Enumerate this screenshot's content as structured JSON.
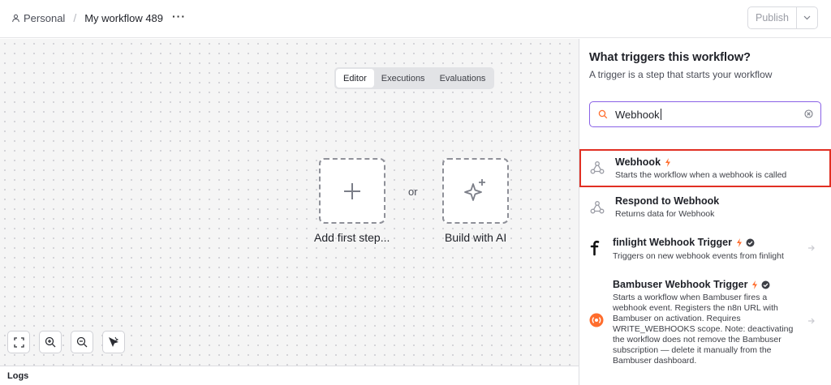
{
  "header": {
    "project": "Personal",
    "workflow_name": "My workflow 489",
    "more": "···",
    "publish_label": "Publish"
  },
  "canvas": {
    "tabs": [
      {
        "label": "Editor",
        "active": true
      },
      {
        "label": "Executions",
        "active": false
      },
      {
        "label": "Evaluations",
        "active": false
      }
    ],
    "add_first_step": "Add first step...",
    "or": "or",
    "build_with_ai": "Build with AI",
    "controls": [
      "fit-view-icon",
      "zoom-in-icon",
      "zoom-out-icon",
      "tidy-up-icon"
    ]
  },
  "logs": {
    "label": "Logs"
  },
  "panel": {
    "title": "What triggers this workflow?",
    "subtitle": "A trigger is a step that starts your workflow",
    "search": {
      "value": "Webhook"
    },
    "results": [
      {
        "name": "Webhook",
        "description": "Starts the workflow when a webhook is called",
        "badge_bolt": true,
        "verified": false,
        "selected": true,
        "icon": "webhook-icon"
      },
      {
        "name": "Respond to Webhook",
        "description": "Returns data for Webhook",
        "badge_bolt": false,
        "verified": false,
        "selected": false,
        "icon": "webhook-icon"
      },
      {
        "name": "finlight Webhook Trigger",
        "description": "Triggers on new webhook events from finlight",
        "badge_bolt": true,
        "verified": true,
        "selected": false,
        "icon": "finlight-logo-icon"
      },
      {
        "name": "Bambuser Webhook Trigger",
        "description_lines": [
          "Starts a workflow when Bambuser fires a",
          "webhook event. Registers the n8n URL with",
          "Bambuser on activation. Requires",
          "WRITE_WEBHOOKS scope. Note: deactivating",
          "the workflow does not remove the Bambuser",
          "subscription — delete it manually from the",
          "Bambuser dashboard."
        ],
        "badge_bolt": true,
        "verified": true,
        "selected": false,
        "icon": "bambuser-logo-icon"
      }
    ],
    "colors": {
      "accent": "#8a62e6",
      "selected_border": "#e12f23",
      "bolt": "#ff6d2d"
    }
  }
}
